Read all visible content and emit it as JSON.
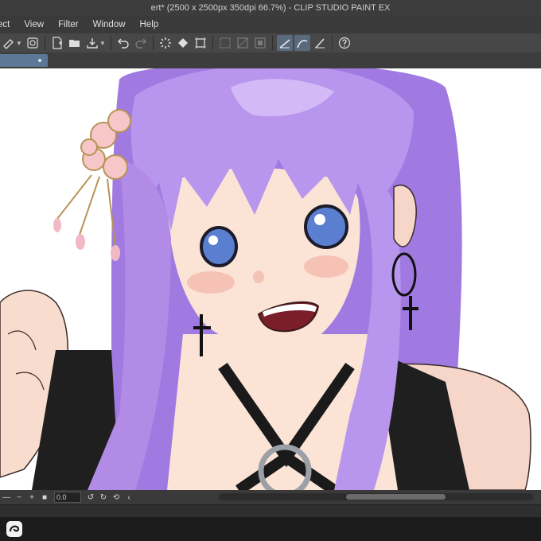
{
  "window": {
    "title": "ert* (2500 x 2500px 350dpi 66.7%) - CLIP STUDIO PAINT EX"
  },
  "menubar": {
    "items": [
      "ect",
      "View",
      "Filter",
      "Window",
      "Help"
    ]
  },
  "toolbar": {
    "icons": [
      "transform-icon",
      "rotate-icon",
      "new-file-icon",
      "open-folder-icon",
      "save-icon",
      "undo-icon",
      "redo-icon",
      "loading-icon",
      "fill-icon",
      "canvas-size-icon",
      "selection-dim-1",
      "selection-dim-2",
      "selection-dim-3",
      "snap-ruler-icon",
      "snap-curve-icon",
      "snap-grid-icon",
      "help-icon"
    ]
  },
  "document_tab": {
    "state": "active"
  },
  "statusbar": {
    "zoom_value": "0.0"
  },
  "colors": {
    "hair": "#b28be6",
    "hair_shadow": "#8e5fd8",
    "skin": "#fbe3d6",
    "blush": "#f2a7a0",
    "dress": "#1f1f1f",
    "accent": "#5b7896"
  }
}
